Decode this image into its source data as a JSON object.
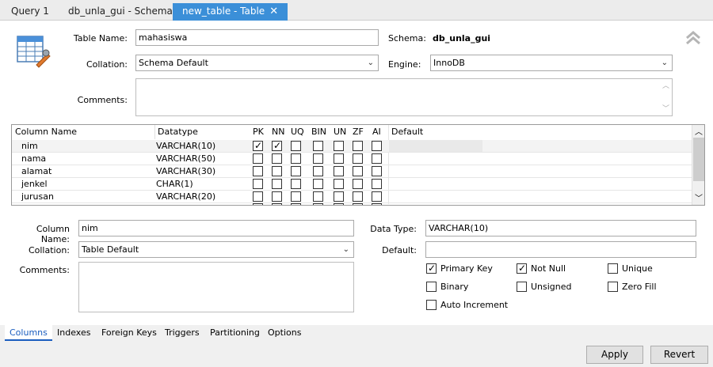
{
  "tabs": [
    {
      "label": "Query 1"
    },
    {
      "label": "db_unla_gui - Schema"
    },
    {
      "label": "new_table - Table"
    }
  ],
  "table": {
    "name_label": "Table Name:",
    "name_value": "mahasiswa",
    "schema_label": "Schema:",
    "schema_value": "db_unla_gui",
    "collation_label": "Collation:",
    "collation_value": "Schema Default",
    "engine_label": "Engine:",
    "engine_value": "InnoDB",
    "comments_label": "Comments:"
  },
  "grid": {
    "headers": [
      "Column Name",
      "Datatype",
      "PK",
      "NN",
      "UQ",
      "BIN",
      "UN",
      "ZF",
      "AI",
      "Default"
    ],
    "rows": [
      {
        "name": "nim",
        "type": "VARCHAR(10)",
        "pk": true,
        "nn": true,
        "uq": false,
        "bin": false,
        "un": false,
        "zf": false,
        "ai": false
      },
      {
        "name": "nama",
        "type": "VARCHAR(50)",
        "pk": false,
        "nn": false,
        "uq": false,
        "bin": false,
        "un": false,
        "zf": false,
        "ai": false
      },
      {
        "name": "alamat",
        "type": "VARCHAR(30)",
        "pk": false,
        "nn": false,
        "uq": false,
        "bin": false,
        "un": false,
        "zf": false,
        "ai": false
      },
      {
        "name": "jenkel",
        "type": "CHAR(1)",
        "pk": false,
        "nn": false,
        "uq": false,
        "bin": false,
        "un": false,
        "zf": false,
        "ai": false
      },
      {
        "name": "jurusan",
        "type": "VARCHAR(20)",
        "pk": false,
        "nn": false,
        "uq": false,
        "bin": false,
        "un": false,
        "zf": false,
        "ai": false
      }
    ]
  },
  "detail": {
    "column_name_label": "Column Name:",
    "column_name_value": "nim",
    "collation_label": "Collation:",
    "collation_value": "Table Default",
    "comments_label": "Comments:",
    "data_type_label": "Data Type:",
    "data_type_value": "VARCHAR(10)",
    "default_label": "Default:",
    "options": {
      "primary_key": {
        "label": "Primary Key",
        "checked": true
      },
      "not_null": {
        "label": "Not Null",
        "checked": true
      },
      "unique": {
        "label": "Unique",
        "checked": false
      },
      "binary": {
        "label": "Binary",
        "checked": false
      },
      "unsigned": {
        "label": "Unsigned",
        "checked": false
      },
      "zero_fill": {
        "label": "Zero Fill",
        "checked": false
      },
      "auto_increment": {
        "label": "Auto Increment",
        "checked": false
      }
    }
  },
  "bottom_tabs": [
    "Columns",
    "Indexes",
    "Foreign Keys",
    "Triggers",
    "Partitioning",
    "Options"
  ],
  "buttons": {
    "apply": "Apply",
    "revert": "Revert"
  },
  "colors": {
    "accent": "#3b8fd8",
    "active_tab_text": "#1a5dbf"
  },
  "icons": {
    "table": "table-edit-icon",
    "collapse": "double-chevron-up-icon",
    "close": "close-icon"
  }
}
